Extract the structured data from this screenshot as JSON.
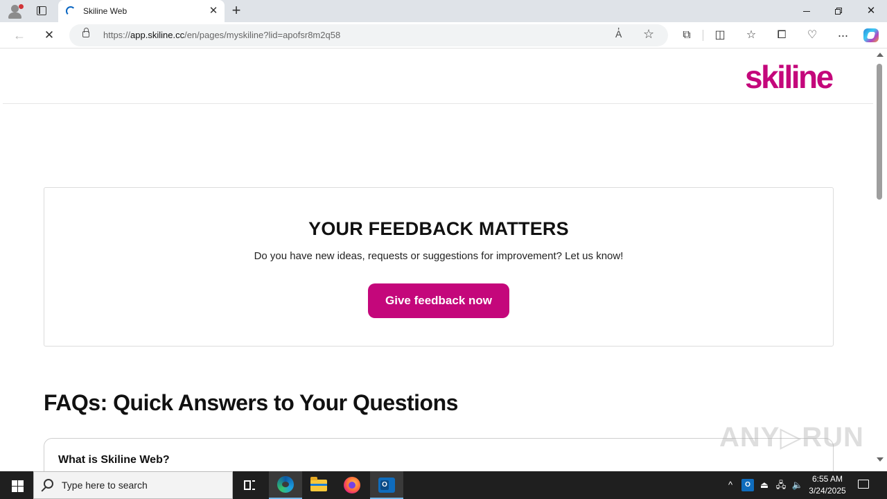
{
  "browser": {
    "tab_title": "Skiline Web",
    "url_prefix": "https://",
    "url_host": "app.skiline.cc",
    "url_path": "/en/pages/myskiline?lid=apofsr8m2q58",
    "read_aloud_label": "A̓",
    "more_label": "···"
  },
  "page": {
    "logo_text": "skiline",
    "feedback": {
      "title": "YOUR FEEDBACK MATTERS",
      "text": "Do you have new ideas, requests or suggestions for improvement? Let us know!",
      "button_label": "Give feedback now"
    },
    "faq": {
      "title": "FAQs: Quick Answers to Your Questions",
      "items": [
        {
          "question": "What is Skiline Web?"
        }
      ]
    },
    "watermark": "ANY▷RUN"
  },
  "taskbar": {
    "search_placeholder": "Type here to search",
    "tray_outlook_label": "O",
    "time": "6:55 AM",
    "date": "3/24/2025"
  },
  "colors": {
    "brand": "#c4077b",
    "taskbar": "#1f1f1f"
  }
}
